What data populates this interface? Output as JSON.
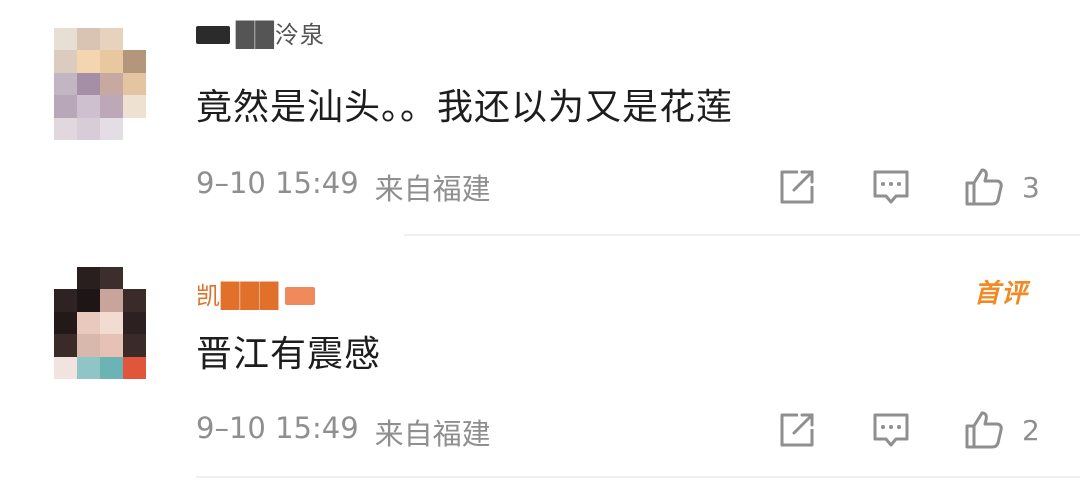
{
  "comments": [
    {
      "username": "██泠泉",
      "text": "竟然是汕头。。我还以为又是花莲",
      "time": "9–10 15:49",
      "location": "来自福建",
      "likes": "3",
      "badge": "",
      "icons": {
        "share": "share-icon",
        "reply": "comment-icon",
        "like": "thumbs-up-icon"
      },
      "avatar_colors": [
        "#e8dfd4",
        "#d9c4b3",
        "#e6d2bd",
        "#ffffff",
        "#dccbbf",
        "#f3d5b0",
        "#e8c89f",
        "#b4967c",
        "#c2b6c4",
        "#a58fa6",
        "#c7a9a2",
        "#e4c5a2",
        "#b8a7b8",
        "#cfc0d0",
        "#bca8b6",
        "#efe1d2",
        "#e1d8de",
        "#d7ccd8",
        "#e5dde5",
        "#ffffff"
      ]
    },
    {
      "username": "凯███",
      "text": "晋江有震感",
      "time": "9–10 15:49",
      "location": "来自福建",
      "likes": "2",
      "badge": "首评",
      "icons": {
        "share": "share-icon",
        "reply": "comment-icon",
        "like": "thumbs-up-icon"
      },
      "avatar_colors": [
        "#ffffff",
        "#2a1f1f",
        "#3b2e2d",
        "#ffffff",
        "#2e2322",
        "#1e1616",
        "#c9a49a",
        "#3a2a28",
        "#231918",
        "#e9c9bd",
        "#f2dcd1",
        "#2c2020",
        "#3a2b29",
        "#d8b7ac",
        "#e6c2b6",
        "#3b2b28",
        "#f1e4de",
        "#8fc5c7",
        "#6cb3b6",
        "#e2553d"
      ]
    }
  ]
}
